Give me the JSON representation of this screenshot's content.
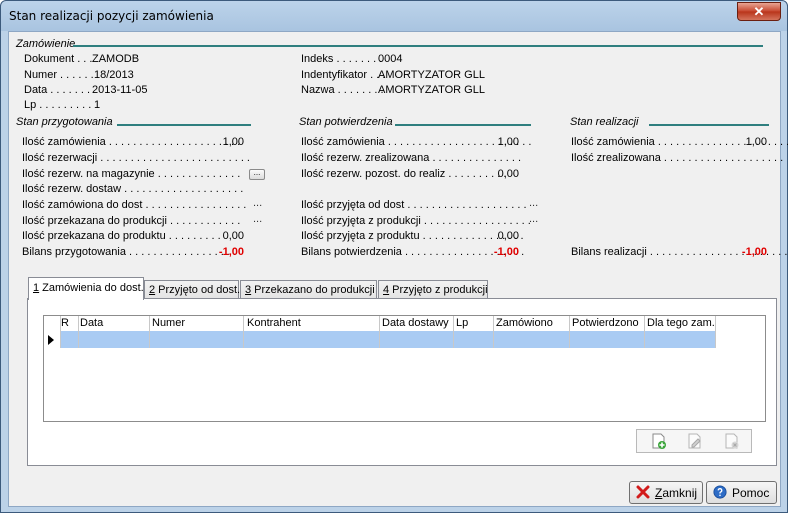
{
  "window": {
    "title": "Stan realizacji pozycji zamówienia",
    "close_glyph": "✕"
  },
  "order": {
    "section": "Zamówienie",
    "left": [
      {
        "label": "Dokument . . .",
        "value": "ZAMODB"
      },
      {
        "label": "Numer . . . . . .",
        "value": "18/2013"
      },
      {
        "label": "Data . . . . . . .",
        "value": "2013-11-05"
      },
      {
        "label": "Lp . . . . . . . . .",
        "value": "1"
      }
    ],
    "right": [
      {
        "label": "Indeks . . . . . . . .",
        "value": "0004"
      },
      {
        "label": "Indentyfikator . . .",
        "value": "AMORTYZATOR GLL"
      },
      {
        "label": "Nazwa . . . . . . . .",
        "value": "AMORTYZATOR GLL"
      }
    ]
  },
  "przygotowania": {
    "section": "Stan przygotowania",
    "rows": [
      {
        "label": "Ilość zamówienia . . . . . . . . . . . . . . . . . . . . . .",
        "value": "1,00"
      },
      {
        "label": "Ilość rezerwacji . . . . . . . . . . . . . . . . . . . . . . . . .",
        "value": ""
      },
      {
        "label": "Ilość rezerw. na magazynie . . . . . . . . . . . . . .",
        "value": ""
      },
      {
        "label": "Ilość rezerw. dostaw . . . . . . . . . . . . . . . . . . . .",
        "value": ""
      },
      {
        "label": "Ilość zamówiona do dost . . . . . . . . . . . . . . . . .",
        "value": ""
      },
      {
        "label": "Ilość przekazana do produkcji . . . . . . . . . . . .",
        "value": ""
      },
      {
        "label": "Ilość przekazana do produktu . . . . . . . . .",
        "value": "0,00"
      },
      {
        "label": "Bilans przygotowania . . . . . . . . . . . . . . . . . .",
        "value": "-1,00"
      }
    ]
  },
  "potwierdzenia": {
    "section": "Stan potwierdzenia",
    "rows": [
      {
        "label": "Ilość zamówienia . . . . . . . . . . . . . . . . . . . . . . . .",
        "value": "1,00"
      },
      {
        "label": "Ilość rezerw. zrealizowana . . . . . . . . . . . . . . .",
        "value": ""
      },
      {
        "label": "Ilość rezerw. pozost. do realiz . . . . . . . . . .",
        "value": "0,00"
      },
      {
        "label": "Ilość przyjęta od dost . . . . . . . . . . . . . . . . . . . .",
        "value": ""
      },
      {
        "label": "Ilość przyjęta z produkcji . . . . . . . . . . . . . . . . . .",
        "value": ""
      },
      {
        "label": "Ilość przyjęta z produktu . . . . . . . . . . . . . . . . .",
        "value": "0,00"
      },
      {
        "label": "Bilans potwierdzenia . . . . . . . . . . . . . . . . . . . .",
        "value": "-1,00"
      }
    ]
  },
  "realizacji": {
    "section": "Stan realizacji",
    "rows": [
      {
        "label": "Ilość zamówienia . . . . . . . . . . . . . . . . . . . . . .",
        "value": "1,00"
      },
      {
        "label": "Ilość zrealizowana . . . . . . . . . . . . . . . . . . . .",
        "value": ""
      },
      {
        "label": "Bilans realizacji . . . . . . . . . . . . . . . . . . . . . . .",
        "value": "-1,00"
      }
    ]
  },
  "ellipsis": "...",
  "tabs": [
    {
      "key": "1",
      "label": " Zamówienia do dost."
    },
    {
      "key": "2",
      "label": " Przyjęto od dost."
    },
    {
      "key": "3",
      "label": " Przekazano do produkcji"
    },
    {
      "key": "4",
      "label": " Przyjęto z produkcji"
    }
  ],
  "grid": {
    "columns": [
      "R",
      "Data",
      "Numer",
      "Kontrahent",
      "Data dostawy",
      "Lp",
      "Zamówiono",
      "Potwierdzono",
      "Dla tego zam."
    ]
  },
  "buttons": {
    "close": {
      "mnemonic": "Z",
      "rest": "amknij"
    },
    "help": {
      "label": "Pomoc"
    }
  },
  "colors": {
    "accent_line": "#2f7f7f",
    "negative": "#e00000",
    "selected_row": "#a9cbf3"
  }
}
